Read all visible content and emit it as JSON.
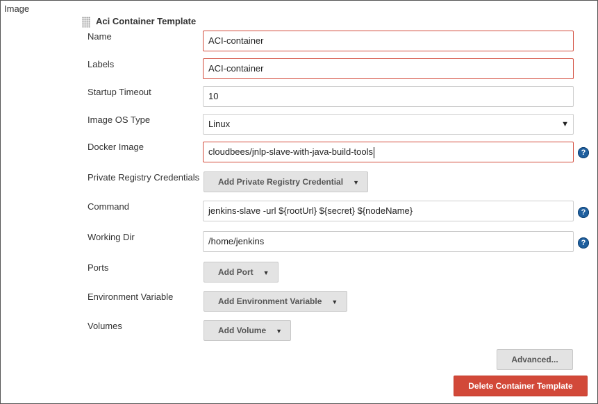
{
  "section": {
    "label": "Image"
  },
  "template": {
    "title": "Aci Container Template"
  },
  "fields": {
    "name": {
      "label": "Name",
      "value": "ACI-container"
    },
    "labels": {
      "label": "Labels",
      "value": "ACI-container"
    },
    "startup_timeout": {
      "label": "Startup Timeout",
      "value": "10"
    },
    "image_os_type": {
      "label": "Image OS Type",
      "value": "Linux"
    },
    "docker_image": {
      "label": "Docker Image",
      "value": "cloudbees/jnlp-slave-with-java-build-tools"
    },
    "private_registry": {
      "label": "Private Registry Credentials",
      "button": "Add Private Registry Credential"
    },
    "command": {
      "label": "Command",
      "value": "jenkins-slave -url ${rootUrl} ${secret} ${nodeName}"
    },
    "working_dir": {
      "label": "Working Dir",
      "value": "/home/jenkins"
    },
    "ports": {
      "label": "Ports",
      "button": "Add Port"
    },
    "env_var": {
      "label": "Environment Variable",
      "button": "Add Environment Variable"
    },
    "volumes": {
      "label": "Volumes",
      "button": "Add Volume"
    }
  },
  "buttons": {
    "advanced": "Advanced...",
    "delete": "Delete Container Template"
  },
  "icons": {
    "help": "?",
    "dropdown": "▼",
    "select_arrow": "▼"
  },
  "colors": {
    "error_border": "#d24939",
    "danger": "#d24939",
    "help": "#1f5f9e"
  }
}
